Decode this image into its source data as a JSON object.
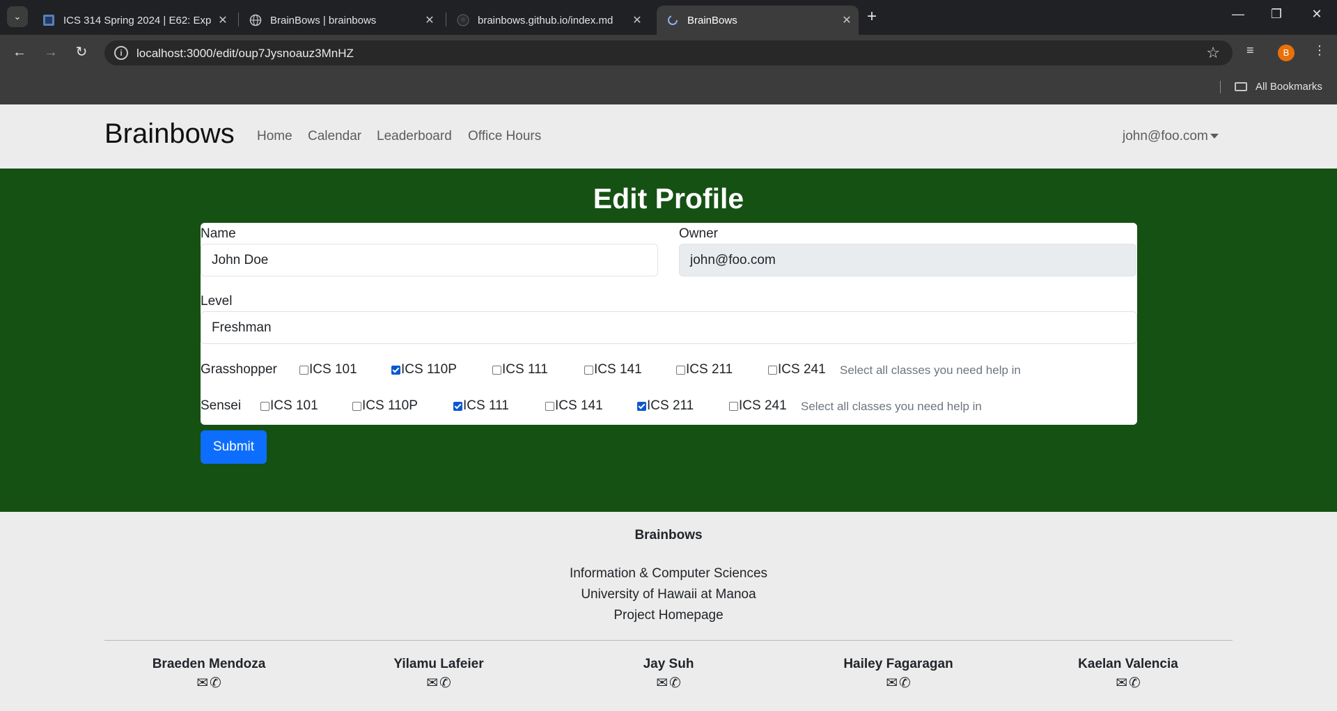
{
  "browser": {
    "tabs": [
      {
        "title": "ICS 314 Spring 2024 | E62: Exp",
        "favicon": "module-icon",
        "active": false
      },
      {
        "title": "BrainBows | brainbows",
        "favicon": "globe-icon",
        "active": false
      },
      {
        "title": "brainbows.github.io/index.md",
        "favicon": "github-icon",
        "active": false
      },
      {
        "title": "BrainBows",
        "favicon": "loading-icon",
        "active": true
      }
    ],
    "url": "localhost:3000/edit/oup7Jysnoauz3MnHZ",
    "bookmarks_label": "All Bookmarks",
    "profile_initial": "B"
  },
  "navbar": {
    "brand": "Brainbows",
    "links": [
      "Home",
      "Calendar",
      "Leaderboard",
      "Office Hours"
    ],
    "user": "john@foo.com"
  },
  "form": {
    "title": "Edit Profile",
    "name_label": "Name",
    "name_value": "John Doe",
    "owner_label": "Owner",
    "owner_value": "john@foo.com",
    "level_label": "Level",
    "level_value": "Freshman",
    "grasshopper": {
      "label": "Grasshopper",
      "options": [
        {
          "label": "ICS 101",
          "checked": false
        },
        {
          "label": "ICS 110P",
          "checked": true
        },
        {
          "label": "ICS 111",
          "checked": false
        },
        {
          "label": "ICS 141",
          "checked": false
        },
        {
          "label": "ICS 211",
          "checked": false
        },
        {
          "label": "ICS 241",
          "checked": false
        }
      ],
      "help": "Select all classes you need help in"
    },
    "sensei": {
      "label": "Sensei",
      "options": [
        {
          "label": "ICS 101",
          "checked": false
        },
        {
          "label": "ICS 110P",
          "checked": false
        },
        {
          "label": "ICS 111",
          "checked": true
        },
        {
          "label": "ICS 141",
          "checked": false
        },
        {
          "label": "ICS 211",
          "checked": true
        },
        {
          "label": "ICS 241",
          "checked": false
        }
      ],
      "help": "Select all classes you need help in"
    },
    "submit_label": "Submit"
  },
  "footer": {
    "brand": "Brainbows",
    "lines": [
      "Information & Computer Sciences",
      "University of Hawaii at Manoa",
      "Project Homepage"
    ],
    "members": [
      "Braeden Mendoza",
      "Yilamu Lafeier",
      "Jay Suh",
      "Hailey Fagaragan",
      "Kaelan Valencia"
    ],
    "member_icons": [
      "envelope-icon",
      "phone-icon"
    ]
  },
  "colors": {
    "main_bg": "#155113",
    "submit": "#0d6efd",
    "checkbox": "#0b57d0"
  }
}
